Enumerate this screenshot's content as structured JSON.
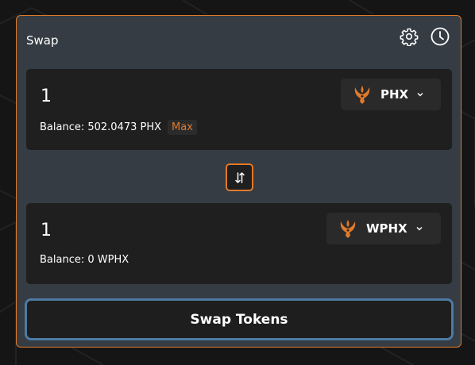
{
  "swap": {
    "title": "Swap",
    "settings_icon": "gear-icon",
    "history_icon": "clock-icon",
    "from": {
      "amount": "1",
      "token_symbol": "PHX",
      "token_icon": "phoenix-logo-icon",
      "balance_text": "Balance: 502.0473 PHX",
      "max_label": "Max"
    },
    "switch_icon": "swap-arrows-icon",
    "to": {
      "amount": "1",
      "token_symbol": "WPHX",
      "token_icon": "phoenix-logo-icon",
      "balance_text": "Balance: 0 WPHX"
    },
    "submit_label": "Swap Tokens"
  },
  "colors": {
    "accent": "#e07a2a",
    "card_bg": "#353c43",
    "field_bg": "#1f1f1f",
    "submit_border": "#4d7aa3",
    "page_bg": "#151515"
  }
}
